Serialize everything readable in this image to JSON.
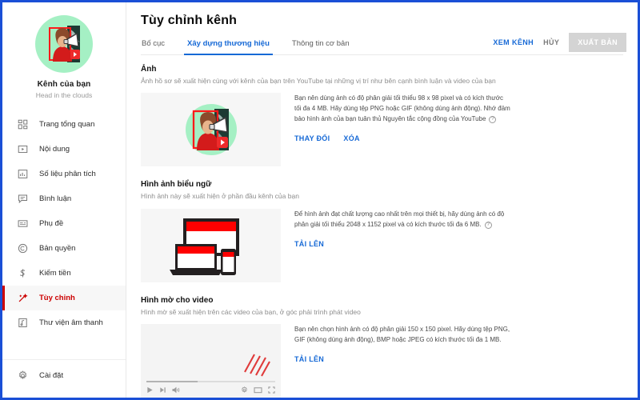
{
  "sidebar": {
    "channel": {
      "name": "Kênh của bạn",
      "tagline": "Head in the clouds",
      "avatar_icon": "woman-with-megaphone-avatar"
    },
    "items": [
      {
        "label": "Trang tổng quan",
        "icon": "dashboard-icon",
        "active": false
      },
      {
        "label": "Nội dung",
        "icon": "video-content-icon",
        "active": false
      },
      {
        "label": "Số liệu phân tích",
        "icon": "analytics-bar-icon",
        "active": false
      },
      {
        "label": "Bình luận",
        "icon": "comment-icon",
        "active": false
      },
      {
        "label": "Phụ đề",
        "icon": "subtitles-icon",
        "active": false
      },
      {
        "label": "Bản quyền",
        "icon": "copyright-icon",
        "active": false
      },
      {
        "label": "Kiếm tiền",
        "icon": "dollar-monetization-icon",
        "active": false
      },
      {
        "label": "Tùy chỉnh",
        "icon": "magic-wand-customize-icon",
        "active": true
      },
      {
        "label": "Thư viện âm thanh",
        "icon": "audio-library-icon",
        "active": false
      }
    ],
    "settings": {
      "label": "Cài đặt",
      "icon": "gear-icon"
    }
  },
  "header": {
    "title": "Tùy chỉnh kênh",
    "tabs": [
      {
        "label": "Bố cục",
        "active": false
      },
      {
        "label": "Xây dựng thương hiệu",
        "active": true
      },
      {
        "label": "Thông tin cơ bản",
        "active": false
      }
    ],
    "actions": {
      "view_channel": "XEM KÊNH",
      "cancel": "HỦY",
      "publish": "XUẤT BẢN"
    }
  },
  "sections": [
    {
      "id": "profile-picture",
      "title": "Ảnh",
      "subtitle": "Ảnh hồ sơ sẽ xuất hiện cùng với kênh của bạn trên YouTube tại những vị trí như bên cạnh bình luận và video của bạn",
      "description": "Bạn nên dùng ảnh có độ phân giải tối thiểu 98 x 98 pixel và có kích thước tối đa 4 MB. Hãy dùng tệp PNG hoặc GIF (không dùng ảnh động). Nhớ đảm bảo hình ảnh của bạn tuân thủ Nguyên tắc cộng đồng của YouTube",
      "help_icon": "?",
      "links": [
        "THAY ĐỔI",
        "XÓA"
      ],
      "preview_icon": "profile-photo-preview"
    },
    {
      "id": "banner-image",
      "title": "Hình ảnh biểu ngữ",
      "subtitle": "Hình ảnh này sẽ xuất hiện ở phần đầu kênh của bạn",
      "description": "Để hình ảnh đạt chất lượng cao nhất trên mọi thiết bị, hãy dùng ảnh có độ phân giải tối thiểu 2048 x 1152 pixel và có kích thước tối đa 6 MB.",
      "help_icon": "?",
      "links": [
        "TẢI LÊN"
      ],
      "preview_icon": "devices-banner-preview"
    },
    {
      "id": "video-watermark",
      "title": "Hình mờ cho video",
      "subtitle": "Hình mờ sẽ xuất hiện trên các video của bạn, ở góc phải trình phát video",
      "description": "Bạn nên chọn hình ảnh có độ phân giải 150 x 150 pixel. Hãy dùng tệp PNG, GIF (không dùng ảnh động), BMP hoặc JPEG có kích thước tối đa 1 MB.",
      "links": [
        "TẢI LÊN"
      ],
      "preview_icon": "video-player-watermark-preview",
      "player_controls": {
        "play": "play-icon",
        "next": "next-track-icon",
        "volume": "volume-icon",
        "settings": "gear-icon",
        "theater": "theater-mode-icon",
        "fullscreen": "fullscreen-icon"
      }
    }
  ],
  "colors": {
    "accent_blue": "#1669d6",
    "active_red": "#cc0000",
    "frame_blue": "#1a4fd6",
    "avatar_green": "#a5f0c4"
  }
}
